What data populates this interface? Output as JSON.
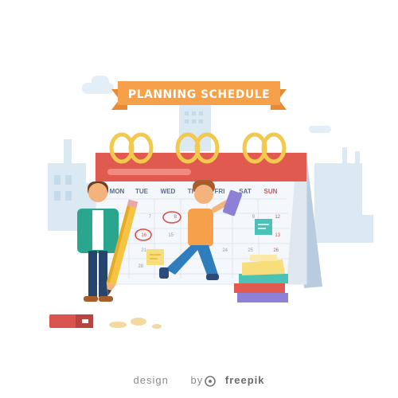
{
  "banner": {
    "title": "PLANNING SCHEDULE"
  },
  "calendar": {
    "days": [
      "MON",
      "TUE",
      "WED",
      "THU",
      "FRI",
      "SAT",
      "SUN"
    ],
    "rows": [
      [
        "",
        "",
        "",
        "",
        "",
        "",
        ""
      ],
      [
        "",
        "",
        "7",
        "8",
        "9",
        "",
        "12"
      ],
      [
        "",
        "16",
        "15",
        "",
        "",
        "",
        "13"
      ],
      [
        "21",
        "",
        "",
        "",
        "24",
        "25",
        "26"
      ],
      [
        "28",
        "",
        "",
        "",
        "",
        "",
        ""
      ]
    ],
    "circled": [
      "8",
      "16"
    ]
  },
  "credit": {
    "prefix": "design",
    "by": "by",
    "brand": "freepik"
  },
  "colors": {
    "calendar_red": "#e05a50",
    "banner_orange": "#f7a04a",
    "ring_gold": "#f2c94c",
    "page_bg": "#eaf2f8",
    "city_blue": "#d4e6f1"
  }
}
